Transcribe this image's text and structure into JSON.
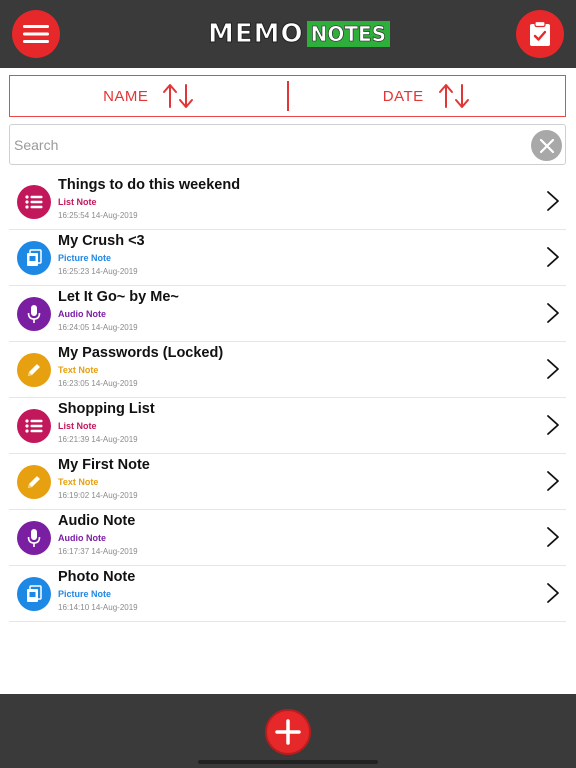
{
  "header": {
    "logo_memo": "MEMO",
    "logo_notes": "NOTES",
    "menu_icon": "hamburger-menu-icon",
    "clipboard_icon": "clipboard-check-icon",
    "bar_color": "#3a3a3a",
    "accent": "#e6282a"
  },
  "sort": {
    "name_label": "NAME",
    "date_label": "DATE",
    "arrows_icon": "sort-arrows-icon"
  },
  "search": {
    "placeholder": "Search",
    "value": "",
    "clear_icon": "close-icon"
  },
  "notes": [
    {
      "title": "Things to do this weekend",
      "type": "List Note",
      "time": "16:25:54 14-Aug-2019",
      "icon": "list-icon",
      "color": "#c2185b"
    },
    {
      "title": "My Crush <3",
      "type": "Picture Note",
      "time": "16:25:23 14-Aug-2019",
      "icon": "picture-icon",
      "color": "#1e88e5"
    },
    {
      "title": "Let It Go~ by Me~",
      "type": "Audio Note",
      "time": "16:24:05 14-Aug-2019",
      "icon": "microphone-icon",
      "color": "#7b1fa2"
    },
    {
      "title": "My Passwords (Locked)",
      "type": "Text Note",
      "time": "16:23:05 14-Aug-2019",
      "icon": "pencil-icon",
      "color": "#e6a010"
    },
    {
      "title": "Shopping List",
      "type": "List Note",
      "time": "16:21:39 14-Aug-2019",
      "icon": "list-icon",
      "color": "#c2185b"
    },
    {
      "title": "My First Note",
      "type": "Text Note",
      "time": "16:19:02 14-Aug-2019",
      "icon": "pencil-icon",
      "color": "#e6a010"
    },
    {
      "title": "Audio Note",
      "type": "Audio Note",
      "time": "16:17:37 14-Aug-2019",
      "icon": "microphone-icon",
      "color": "#7b1fa2"
    },
    {
      "title": "Photo Note",
      "type": "Picture Note",
      "time": "16:14:10 14-Aug-2019",
      "icon": "picture-icon",
      "color": "#1e88e5"
    }
  ],
  "footer": {
    "add_icon": "plus-icon"
  }
}
